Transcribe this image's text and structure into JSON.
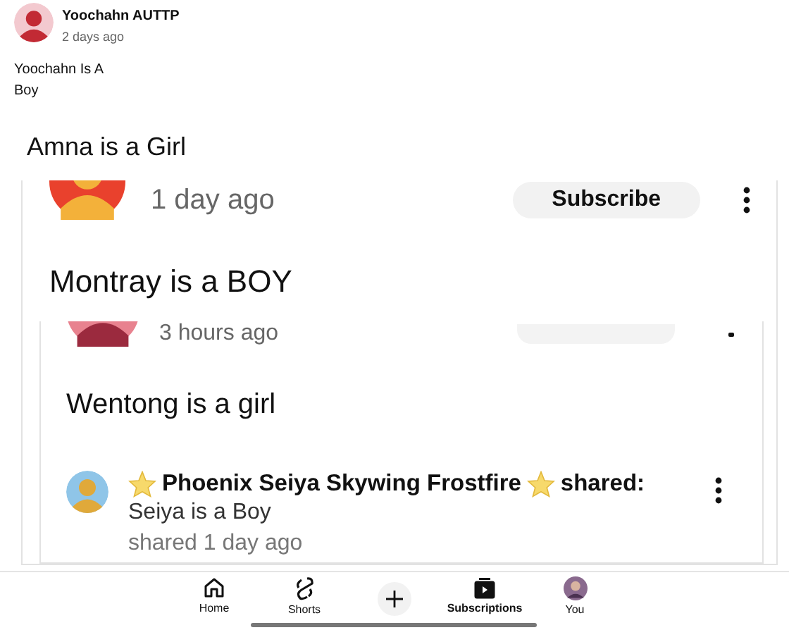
{
  "post": {
    "author": "Yoochahn AUTTP",
    "time": "2 days ago",
    "text": "Yoochahn Is A Boy"
  },
  "screenshot": {
    "title": "Amna is a Girl",
    "card": {
      "time": "1 day ago",
      "subscribe": "Subscribe",
      "text": "Montray is a BOY",
      "inner": {
        "time": "3 hours ago",
        "text": "Wentong is a girl",
        "share": {
          "author": "Phoenix Seiya Skywing Frostfire",
          "action": "shared:",
          "text": "Seiya is a Boy",
          "time": "shared 1 day ago"
        }
      }
    }
  },
  "nav": [
    {
      "kind": "home",
      "label": "Home",
      "selected": false
    },
    {
      "kind": "shorts",
      "label": "Shorts",
      "selected": false
    },
    {
      "kind": "create",
      "selected": false
    },
    {
      "kind": "subscriptions",
      "label": "Subscriptions",
      "selected": true
    },
    {
      "kind": "you",
      "label": "You",
      "selected": false
    }
  ]
}
